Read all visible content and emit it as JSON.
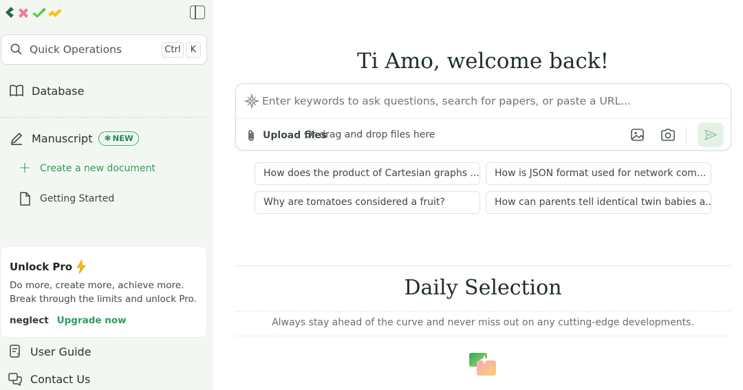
{
  "sidebar": {
    "logo_icon": "brand-logo-icon",
    "toggle_icon": "sidebar-toggle-icon",
    "search": {
      "label": "Quick Operations",
      "kbd_ctrl": "Ctrl",
      "kbd_k": "K"
    },
    "database": "Database",
    "manuscript": "Manuscript",
    "new_badge": "NEW",
    "create_doc": "Create a new document",
    "getting_started": "Getting Started",
    "pro": {
      "title": "Unlock Pro",
      "desc_line1": "Do more, create more, achieve more.",
      "desc_line2": "Break through the limits and unlock Pro.",
      "neglect": "neglect",
      "upgrade": "Upgrade now"
    },
    "user_guide": "User Guide",
    "contact_us": "Contact Us"
  },
  "main": {
    "welcome": "Ti Amo, welcome back!",
    "composer": {
      "placeholder": "Enter keywords to ask questions, search for papers, or paste a URL...",
      "upload_label": "Upload files",
      "drag_text": "Or drag and drop files here"
    },
    "suggestions": [
      "How does the product of Cartesian graphs ...",
      "How is JSON format used for network com...",
      "Why are tomatoes considered a fruit?",
      "How can parents tell identical twin babies a..."
    ],
    "daily_title": "Daily Selection",
    "daily_subtitle": "Always stay ahead of the curve and never miss out on any cutting-edge developments."
  },
  "colors": {
    "accent": "#2a9d5c",
    "sidebar_bg": "#f3f7f2"
  }
}
